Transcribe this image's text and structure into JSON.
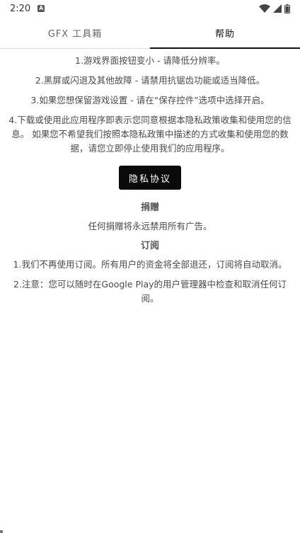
{
  "status_bar": {
    "time": "2:20",
    "notification_icon_glyph": "A",
    "icons": [
      "wifi-icon",
      "signal-icon",
      "battery-icon"
    ]
  },
  "tabs": [
    {
      "label": "GFX 工具箱",
      "active": false
    },
    {
      "label": "帮助",
      "active": true
    }
  ],
  "help": {
    "items": [
      "1.游戏界面按钮变小 - 请降低分辨率。",
      "2.黑屏或闪退及其他故障 - 请禁用抗锯齿功能或适当降低。",
      "3.如果您想保留游戏设置 - 请在“保存控件”选项中选择开启。",
      "4.下载或使用此应用程序即表示您同意根据本隐私政策收集和使用您的信息。 如果您不希望我们按照本隐私政策中描述的方式收集和使用您的数据，请您立即停止使用我们的应用程序。"
    ],
    "privacy_button": "隐私协议"
  },
  "donate": {
    "title": "捐赠",
    "text": "任何捐赠将永远禁用所有广告。"
  },
  "subscription": {
    "title": "订阅",
    "items": [
      "1.我们不再使用订阅。所有用户的资金将全部退还，订阅将自动取消。",
      "2.注意：您可以随时在Google Play的用户管理器中检查和取消任何订阅。"
    ]
  },
  "colors": {
    "accent": "#111111",
    "button_bg": "#0a0a0a",
    "text": "#4a4a4a"
  }
}
